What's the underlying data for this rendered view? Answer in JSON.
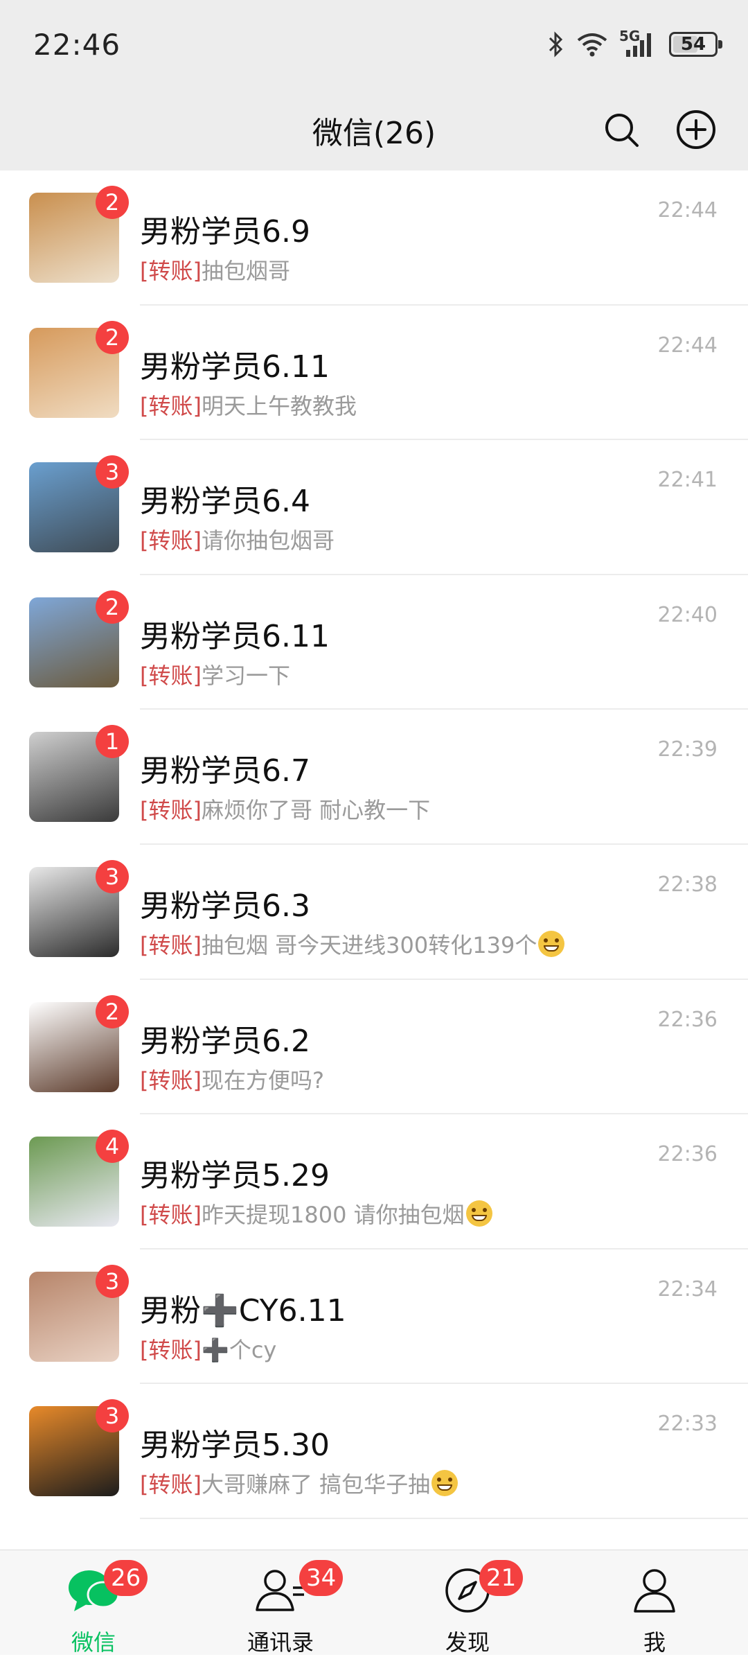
{
  "status_bar": {
    "time": "22:46",
    "battery": "54",
    "network": "5G"
  },
  "header": {
    "title": "微信(26)"
  },
  "chats": [
    {
      "name": "男粉学员6.9",
      "tag": "[转账]",
      "message": "抽包烟哥",
      "time": "22:44",
      "badge": "2",
      "avatar_colors": [
        "#c98f4e",
        "#ede0cc"
      ],
      "emoji": false
    },
    {
      "name": "男粉学员6.11",
      "tag": "[转账]",
      "message": "明天上午教教我",
      "time": "22:44",
      "badge": "2",
      "avatar_colors": [
        "#d69a5c",
        "#f0dcc2"
      ],
      "emoji": false
    },
    {
      "name": "男粉学员6.4",
      "tag": "[转账]",
      "message": "请你抽包烟哥",
      "time": "22:41",
      "badge": "3",
      "avatar_colors": [
        "#6a9fcf",
        "#3f4b55"
      ],
      "emoji": false
    },
    {
      "name": "男粉学员6.11",
      "tag": "[转账]",
      "message": "学习一下",
      "time": "22:40",
      "badge": "2",
      "avatar_colors": [
        "#7fa7d8",
        "#6b5a3c"
      ],
      "emoji": false
    },
    {
      "name": "男粉学员6.7",
      "tag": "[转账]",
      "message": "麻烦你了哥 耐心教一下",
      "time": "22:39",
      "badge": "1",
      "avatar_colors": [
        "#cfcfcf",
        "#3a3a3a"
      ],
      "emoji": false
    },
    {
      "name": "男粉学员6.3",
      "tag": "[转账]",
      "message": "抽包烟 哥今天进线300转化139个",
      "time": "22:38",
      "badge": "3",
      "avatar_colors": [
        "#e8e8e8",
        "#2b2b2b"
      ],
      "emoji": true
    },
    {
      "name": "男粉学员6.2",
      "tag": "[转账]",
      "message": "现在方便吗?",
      "time": "22:36",
      "badge": "2",
      "avatar_colors": [
        "#ffffff",
        "#5b3a2a"
      ],
      "emoji": false
    },
    {
      "name": "男粉学员5.29",
      "tag": "[转账]",
      "message": "昨天提现1800 请你抽包烟",
      "time": "22:36",
      "badge": "4",
      "avatar_colors": [
        "#6c9a52",
        "#e9e9f2"
      ],
      "emoji": true
    },
    {
      "name": "男粉➕CY6.11",
      "tag": "[转账]",
      "message": "➕个cy",
      "time": "22:34",
      "badge": "3",
      "avatar_colors": [
        "#b7856a",
        "#e9d2c4"
      ],
      "emoji": false
    },
    {
      "name": "男粉学员5.30",
      "tag": "[转账]",
      "message": "大哥赚麻了 搞包华子抽",
      "time": "22:33",
      "badge": "3",
      "avatar_colors": [
        "#e88a2a",
        "#1c1c1c"
      ],
      "emoji": true
    }
  ],
  "tabs": [
    {
      "label": "微信",
      "badge": "26",
      "active": true,
      "icon": "chat-bubbles-icon"
    },
    {
      "label": "通讯录",
      "badge": "34",
      "active": false,
      "icon": "contacts-icon"
    },
    {
      "label": "发现",
      "badge": "21",
      "active": false,
      "icon": "compass-icon"
    },
    {
      "label": "我",
      "badge": "",
      "active": false,
      "icon": "person-icon"
    }
  ],
  "colors": {
    "accent": "#07c160",
    "badge": "#f44040",
    "tag": "#d04a4a"
  }
}
